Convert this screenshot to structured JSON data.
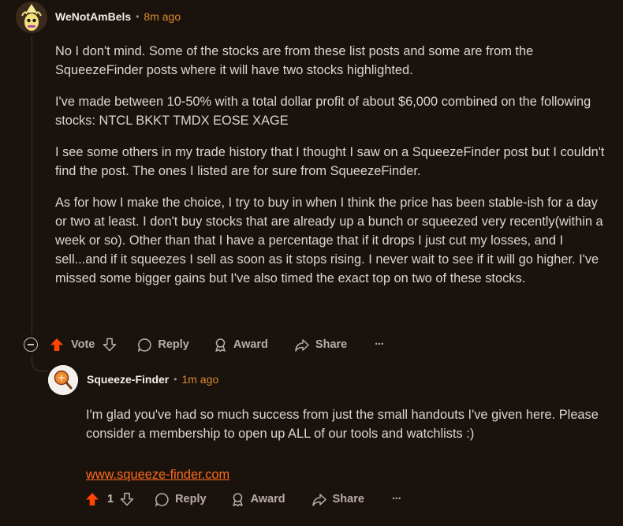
{
  "comment": {
    "author": "WeNotAmBels",
    "separator": "•",
    "time": "8m ago",
    "paragraphs": [
      "No I don't mind. Some of the stocks are from these list posts and some are from the SqueezeFinder posts where it will have two stocks highlighted.",
      "I've made between 10-50% with a total dollar profit of about $6,000 combined on the following stocks: NTCL BKKT TMDX EOSE XAGE",
      "I see some others in my trade history that I thought I saw on a SqueezeFinder post but I couldn't find the post. The ones I listed are for sure from SqueezeFinder.",
      "As for how I make the choice, I try to buy in when I think the price has been stable-ish for a day or two at least. I don't buy stocks that are already up a bunch or squeezed very recently(within a week or so). Other than that I have a percentage that if it drops I just cut my losses, and I sell...and if it squeezes I sell as soon as it stops rising. I never wait to see if it will go higher. I've missed some bigger gains but I've also timed the exact top on two of these stocks."
    ],
    "actions": {
      "vote_label": "Vote",
      "reply_label": "Reply",
      "award_label": "Award",
      "share_label": "Share",
      "more_label": "···"
    }
  },
  "reply": {
    "author": "Squeeze-Finder",
    "separator": "•",
    "time": "1m ago",
    "paragraphs": [
      "I'm glad you've had so much success from just the small handouts I've given here. Please consider a membership to open up ALL of our tools and watchlists :)"
    ],
    "link_text": "www.squeeze-finder.com",
    "actions": {
      "vote_count": "1",
      "reply_label": "Reply",
      "award_label": "Award",
      "share_label": "Share",
      "more_label": "···"
    }
  },
  "colors": {
    "background": "#1a120d",
    "upvote": "#ff4500",
    "timestamp": "#d98a2e",
    "link": "#ff6a1a"
  }
}
